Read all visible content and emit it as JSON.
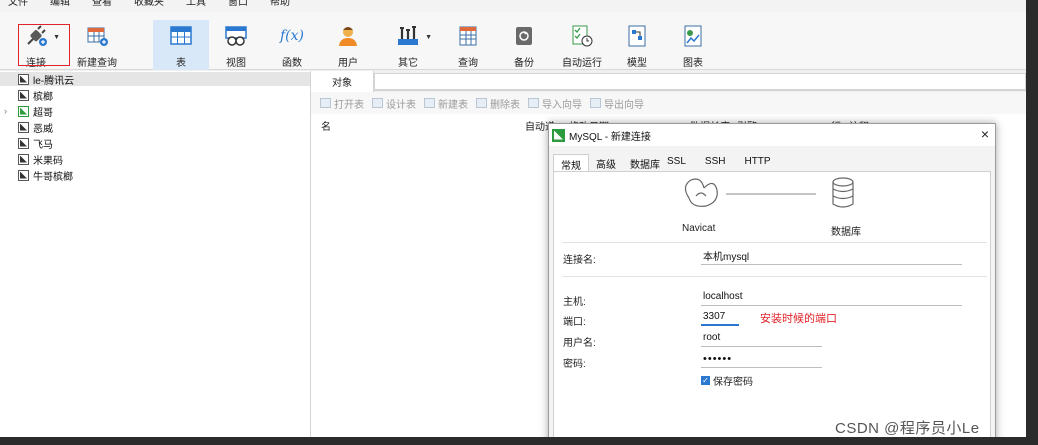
{
  "menu": [
    "文件",
    "编辑",
    "查看",
    "收藏夹",
    "工具",
    "窗口",
    "帮助"
  ],
  "toolbar": {
    "items": [
      {
        "label": "连接",
        "icon": "plug-icon"
      },
      {
        "label": "新建查询",
        "icon": "new-query-icon"
      },
      {
        "label": "表",
        "icon": "table-icon"
      },
      {
        "label": "视图",
        "icon": "view-icon"
      },
      {
        "label": "函数",
        "icon": "function-icon"
      },
      {
        "label": "用户",
        "icon": "user-icon"
      },
      {
        "label": "其它",
        "icon": "tools-icon"
      },
      {
        "label": "查询",
        "icon": "query-icon"
      },
      {
        "label": "备份",
        "icon": "backup-icon"
      },
      {
        "label": "自动运行",
        "icon": "auto-run-icon"
      },
      {
        "label": "模型",
        "icon": "model-icon"
      },
      {
        "label": "图表",
        "icon": "chart-icon"
      }
    ],
    "function_glyph": "f(x)"
  },
  "nav": {
    "items": [
      "le-腾讯云",
      "槟榔",
      "超哥",
      "恶威",
      "飞马",
      "米果码",
      "牛哥槟榔"
    ]
  },
  "tabs": {
    "objects": "对象"
  },
  "object_toolbar": [
    "打开表",
    "设计表",
    "新建表",
    "删除表",
    "导入向导",
    "导出向导"
  ],
  "grid_headers": [
    "名",
    "自动递",
    "修改日期",
    "数据长度",
    "引擎",
    "行",
    "注释"
  ],
  "dialog": {
    "title": "MySQL - 新建连接",
    "close": "×",
    "tabs": [
      "常规",
      "高级",
      "数据库",
      "SSL",
      "SSH",
      "HTTP"
    ],
    "navicat_label": "Navicat",
    "db_label": "数据库",
    "fields": {
      "conn_name": {
        "label": "连接名:",
        "value": "本机mysql"
      },
      "host": {
        "label": "主机:",
        "value": "localhost"
      },
      "port": {
        "label": "端口:",
        "value": "3307"
      },
      "user": {
        "label": "用户名:",
        "value": "root"
      },
      "password": {
        "label": "密码:",
        "value": "••••••"
      }
    },
    "port_note": "安装时候的端口",
    "save_password": "保存密码"
  },
  "watermark": "CSDN @程序员小Le",
  "colors": {
    "accent_red": "#e0242b",
    "accent_blue": "#2b78d0",
    "navicat_green": "#2c9b3d"
  }
}
